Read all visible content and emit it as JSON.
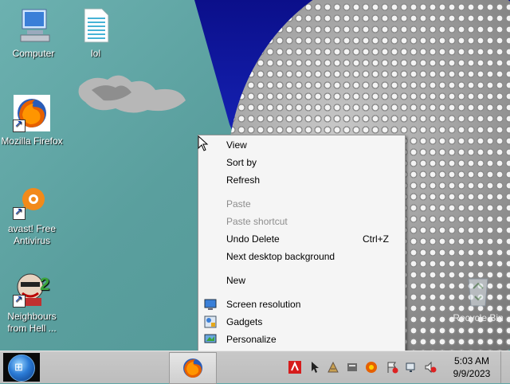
{
  "desktop": {
    "icons": [
      {
        "label": "Computer"
      },
      {
        "label": "lol"
      },
      {
        "label": "Mozilla Firefox"
      },
      {
        "label": "avast! Free Antivirus"
      },
      {
        "label": "Neighbours from Hell ..."
      },
      {
        "label": "Recycle Bin"
      }
    ]
  },
  "context_menu": {
    "items": [
      {
        "label": "View"
      },
      {
        "label": "Sort by"
      },
      {
        "label": "Refresh"
      },
      {
        "label": "Paste",
        "disabled": true
      },
      {
        "label": "Paste shortcut",
        "disabled": true
      },
      {
        "label": "Undo Delete",
        "shortcut": "Ctrl+Z"
      },
      {
        "label": "Next desktop background"
      },
      {
        "label": "New"
      },
      {
        "label": "Screen resolution",
        "icon": "monitor-icon"
      },
      {
        "label": "Gadgets",
        "icon": "gadgets-icon"
      },
      {
        "label": "Personalize",
        "icon": "personalize-icon"
      }
    ]
  },
  "taskbar": {
    "time": "5:03 AM",
    "date": "9/9/2023",
    "pinned": [
      {
        "icon": "firefox-icon"
      }
    ],
    "tray_icons": [
      "avira-icon",
      "cursor-tray-icon",
      "network-tool-icon",
      "tray-app-icon",
      "flag-icon",
      "network-icon",
      "volume-icon"
    ]
  },
  "colors": {
    "desktop_teal": "#5fa7a5",
    "sky_blue": "#1420b0",
    "menu_bg": "#f5f5f5",
    "disabled_text": "#8d8d8d",
    "taskbar_bg": "#c3c3c3"
  }
}
